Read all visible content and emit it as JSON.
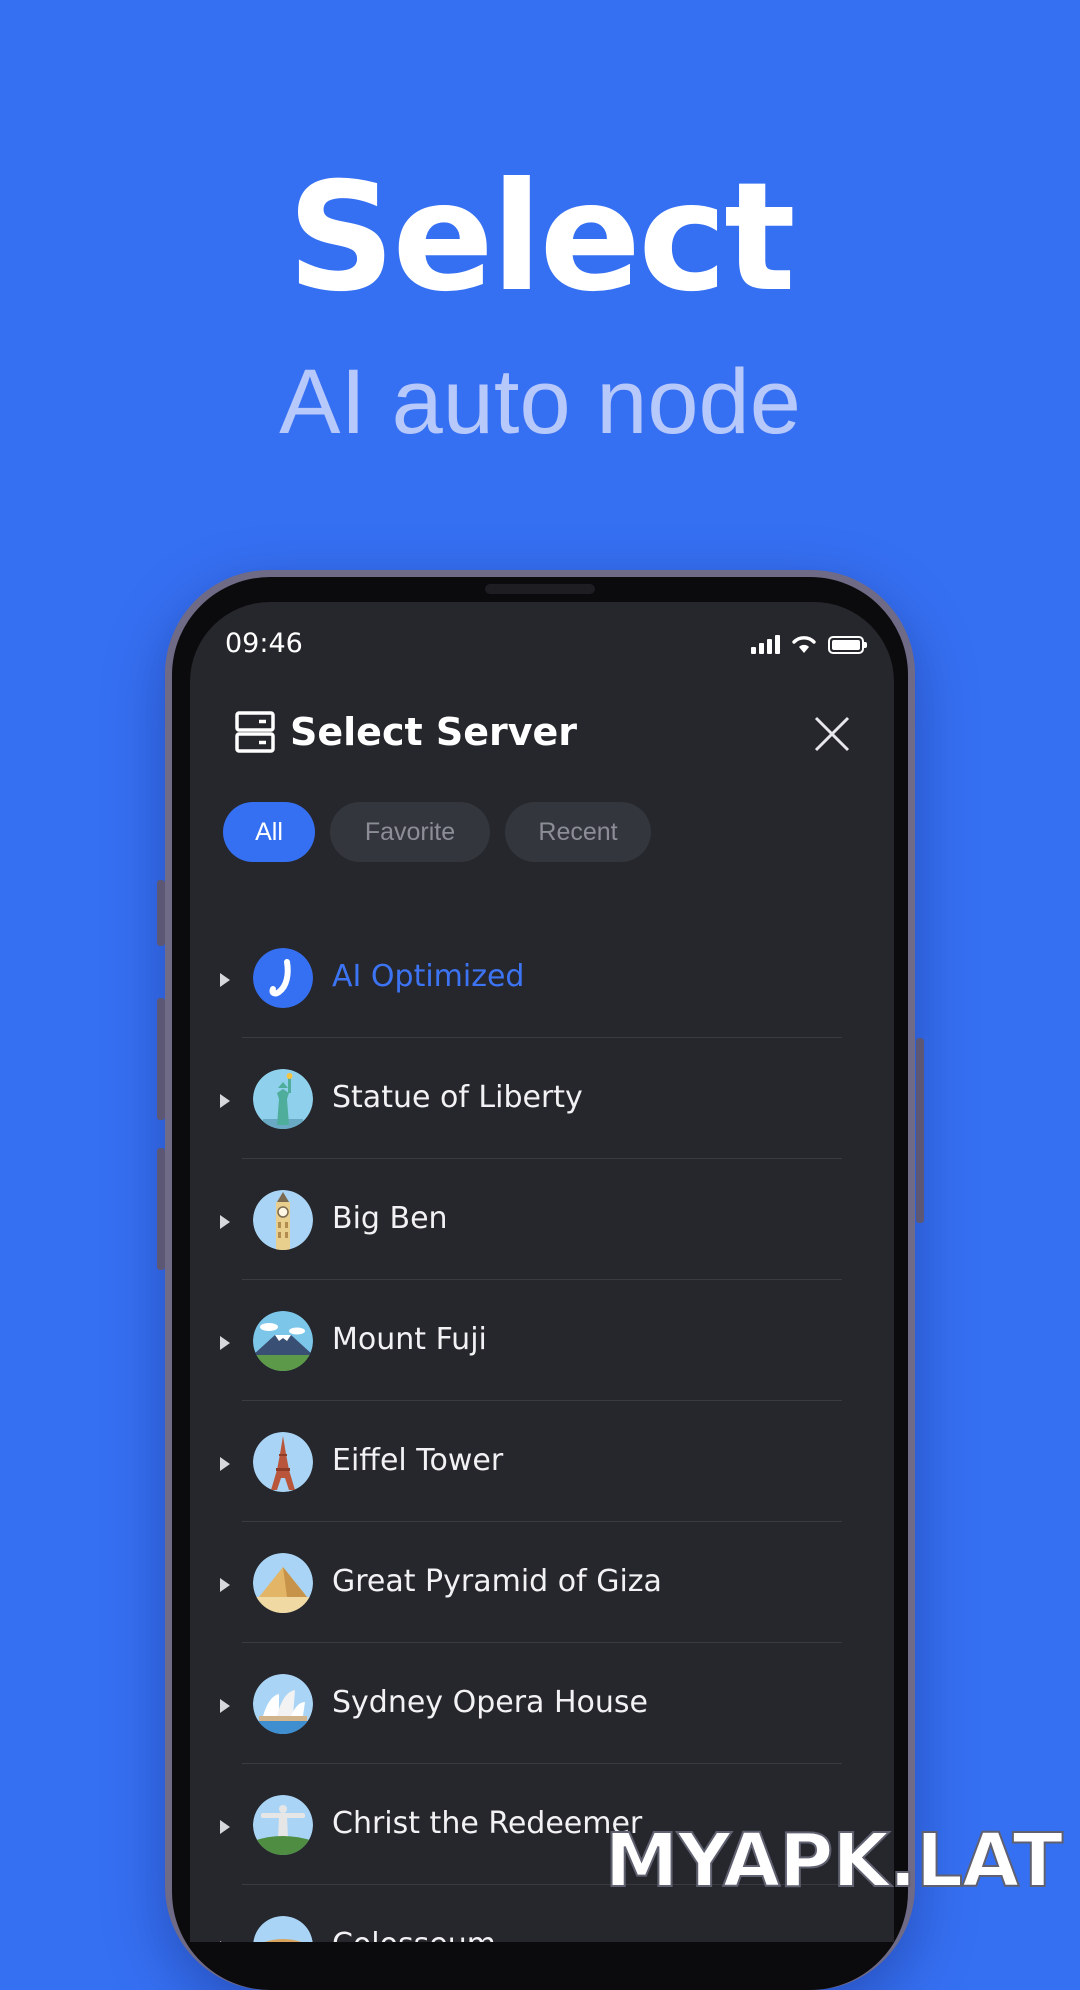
{
  "promo": {
    "headline": "Select",
    "subline": "AI auto node"
  },
  "status_bar": {
    "time": "09:46",
    "icons": [
      "signal-icon",
      "wifi-icon",
      "battery-icon"
    ]
  },
  "header": {
    "title": "Select Server",
    "icon": "server-icon",
    "close_icon": "close-icon"
  },
  "filters": [
    {
      "label": "All",
      "active": true
    },
    {
      "label": "Favorite",
      "active": false
    },
    {
      "label": "Recent",
      "active": false
    }
  ],
  "servers": [
    {
      "label": "AI Optimized",
      "icon": "ai-logo-icon",
      "highlight": true
    },
    {
      "label": "Statue of Liberty",
      "icon": "statue-of-liberty-icon"
    },
    {
      "label": "Big Ben",
      "icon": "big-ben-icon"
    },
    {
      "label": "Mount Fuji",
      "icon": "mount-fuji-icon"
    },
    {
      "label": "Eiffel Tower",
      "icon": "eiffel-tower-icon"
    },
    {
      "label": "Great Pyramid of Giza",
      "icon": "pyramid-icon"
    },
    {
      "label": "Sydney Opera House",
      "icon": "opera-house-icon"
    },
    {
      "label": "Christ the Redeemer",
      "icon": "christ-redeemer-icon"
    },
    {
      "label": "Colosseum",
      "icon": "colosseum-icon"
    }
  ],
  "colors": {
    "background": "#3670f2",
    "accent": "#3c74f4",
    "screen": "#26272c"
  },
  "watermark": "MYAPK.LAT"
}
